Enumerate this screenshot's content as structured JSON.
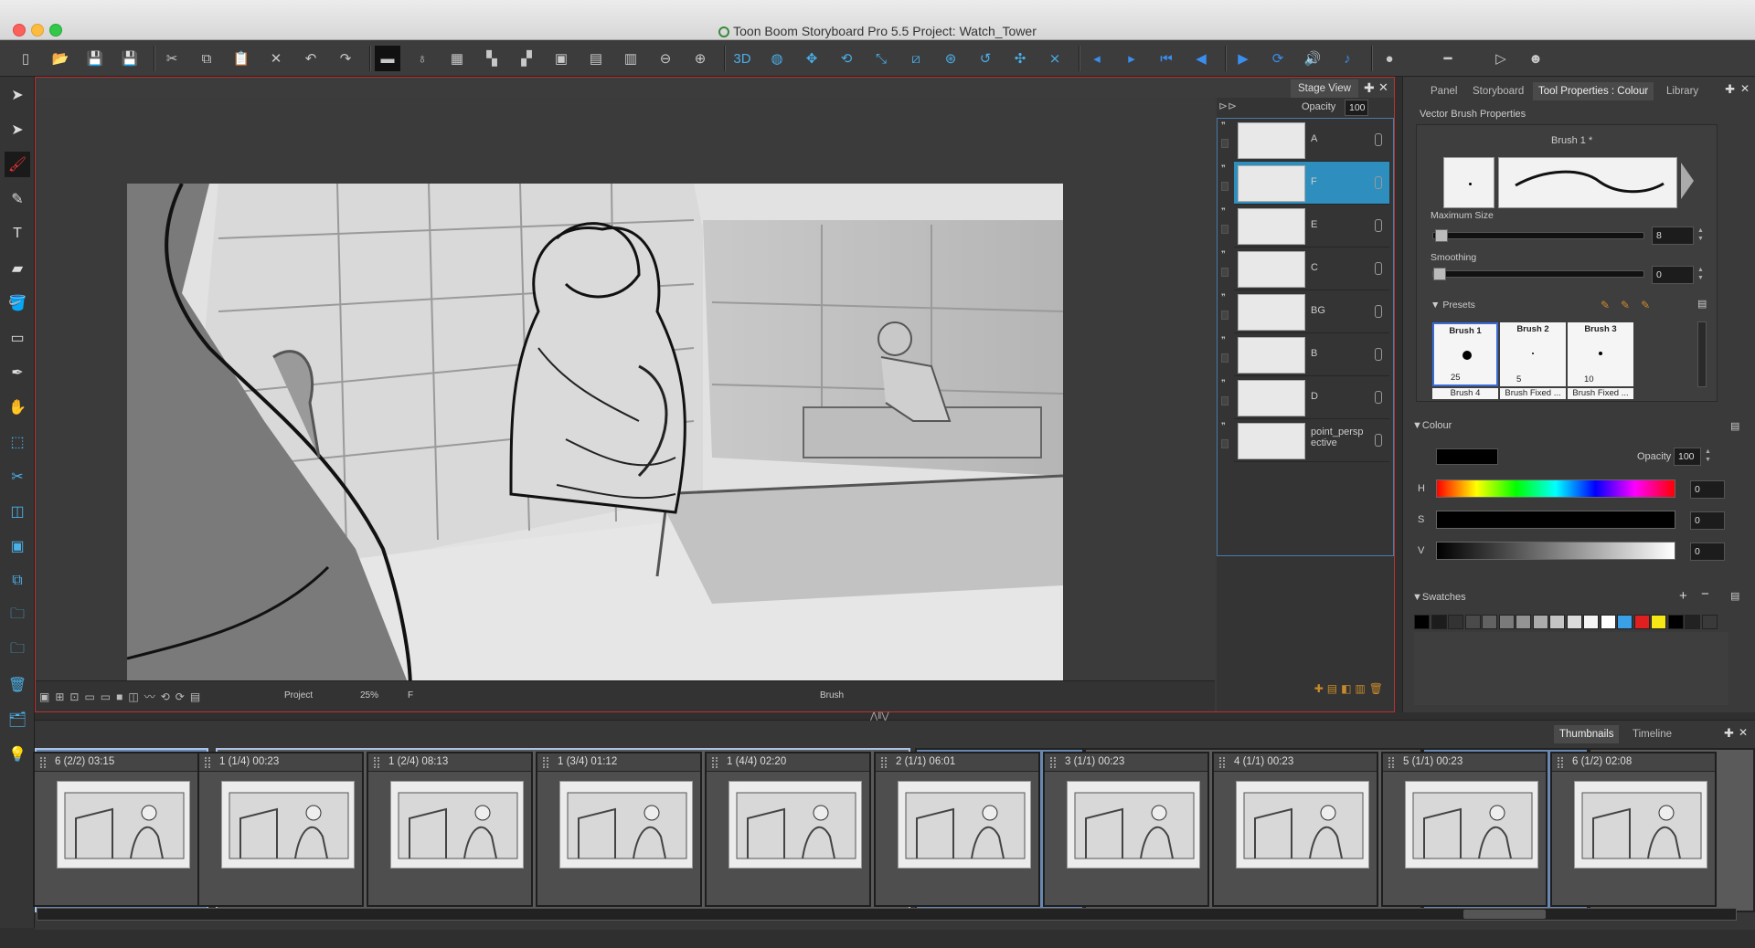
{
  "window": {
    "title": "Toon Boom Storyboard Pro 5.5 Project: Watch_Tower"
  },
  "toolbar": {
    "icons": [
      "new-icon",
      "open-icon",
      "save-icon",
      "save-all-icon",
      "cut-icon",
      "copy-icon",
      "paste-icon",
      "delete-icon",
      "undo-icon",
      "redo-icon",
      "filmstrip-icon",
      "light-table-icon",
      "grid-icon",
      "layout-icon",
      "layout2-icon",
      "layout3-icon",
      "layout4-icon",
      "layout5-icon",
      "zoom-out-icon",
      "zoom-in-icon",
      "3d-icon",
      "camera-icon",
      "move-icon",
      "rotate-icon",
      "scale-icon",
      "skew-icon",
      "pivot-icon",
      "reset-icon",
      "motion-icon",
      "snap-icon",
      "prev-icon",
      "next-icon",
      "first-icon",
      "play-back-icon",
      "play-icon",
      "loop-icon",
      "sound-icon",
      "scrub-icon",
      "record-icon",
      "volume-icon",
      "end-icon",
      "person-icon"
    ]
  },
  "left_tools": [
    "select-arrow-icon",
    "transform-arrow-icon",
    "brush-icon",
    "pencil-icon",
    "text-icon",
    "eraser-icon",
    "paint-bucket-icon",
    "rectangle-icon",
    "dropper-icon",
    "hand-icon",
    "bounding-box-icon",
    "cut-tool-icon",
    "layer-tool-icon",
    "camera-tool-icon",
    "transform-tool-icon",
    "add-scene-icon",
    "add-panel-icon",
    "delete-panel-icon",
    "import-icon",
    "tips-bulb-icon"
  ],
  "stage": {
    "tab_label": "Stage View",
    "opacity_label": "Opacity",
    "opacity_value": "100",
    "status": {
      "mode": "Project",
      "zoom": "25%",
      "layer": "F",
      "tool": "Brush"
    }
  },
  "layers": [
    {
      "name": "A",
      "selected": false
    },
    {
      "name": "F",
      "selected": true
    },
    {
      "name": "E",
      "selected": false
    },
    {
      "name": "C",
      "selected": false
    },
    {
      "name": "BG",
      "selected": false
    },
    {
      "name": "B",
      "selected": false
    },
    {
      "name": "D",
      "selected": false
    },
    {
      "name": "point_persp ective",
      "selected": false
    }
  ],
  "right_panel": {
    "tabs": [
      "Panel",
      "Storyboard",
      "Tool Properties : Colour",
      "Library"
    ],
    "active_tab": "Tool Properties : Colour",
    "vector_brush": {
      "heading": "Vector Brush Properties",
      "brush_name": "Brush 1 *",
      "max_size_label": "Maximum Size",
      "max_size_value": "8",
      "smoothing_label": "Smoothing",
      "smoothing_value": "0",
      "presets_label": "Presets",
      "presets": [
        {
          "name": "Brush 1",
          "size": "25"
        },
        {
          "name": "Brush 2",
          "size": "5"
        },
        {
          "name": "Brush 3",
          "size": "10"
        }
      ],
      "presets_row2": [
        "Brush 4",
        "Brush Fixed ...",
        "Brush Fixed ..."
      ]
    },
    "colour": {
      "heading": "Colour",
      "opacity_label": "Opacity",
      "opacity_value": "100",
      "swatch_color": "#000000",
      "h_label": "H",
      "h_value": "0",
      "s_label": "S",
      "s_value": "0",
      "v_label": "V",
      "v_value": "0"
    },
    "swatches": {
      "heading": "Swatches",
      "colors": [
        "#000000",
        "#1c1c1c",
        "#333333",
        "#4a4a4a",
        "#626262",
        "#7a7a7a",
        "#939393",
        "#ababab",
        "#c4c4c4",
        "#dcdcdc",
        "#f5f5f5",
        "#ffffff",
        "#3aa0e8",
        "#e02020",
        "#f5e616",
        "#000000",
        "#222222",
        "#3a3a3a"
      ]
    }
  },
  "thumbnails": {
    "tabs": [
      "Thumbnails",
      "Timeline"
    ],
    "active_tab": "Thumbnails",
    "panels": [
      {
        "label": "6 (2/2) 03:15"
      },
      {
        "label": "1 (1/4) 00:23"
      },
      {
        "label": "1 (2/4) 08:13"
      },
      {
        "label": "1 (3/4) 01:12"
      },
      {
        "label": "1 (4/4) 02:20"
      },
      {
        "label": "2 (1/1) 06:01"
      },
      {
        "label": "3 (1/1) 00:23"
      },
      {
        "label": "4 (1/1) 00:23"
      },
      {
        "label": "5 (1/1) 00:23"
      },
      {
        "label": "6 (1/2) 02:08"
      }
    ]
  }
}
